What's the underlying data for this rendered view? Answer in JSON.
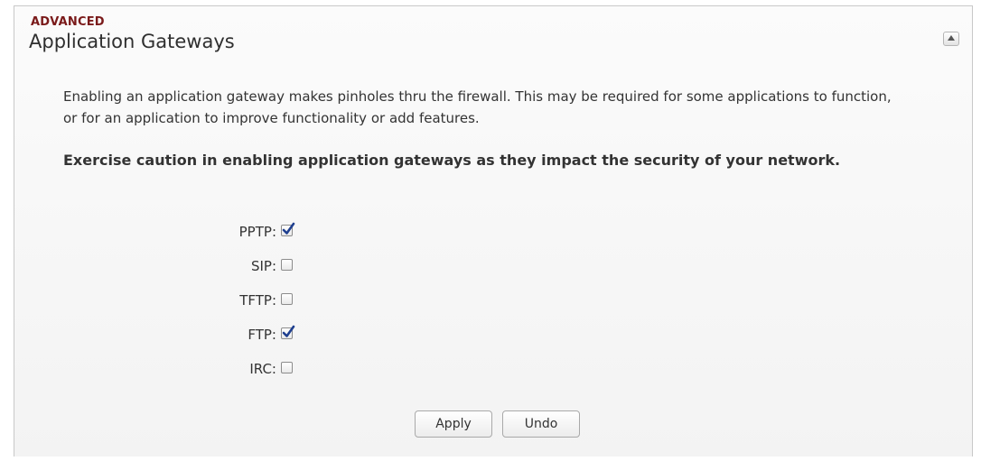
{
  "header": {
    "section": "ADVANCED",
    "title": "Application Gateways",
    "collapse_icon": "collapse-up-icon"
  },
  "description": "Enabling an application gateway makes pinholes thru the firewall. This may be required for some applications to function, or for an application to improve functionality or add features.",
  "warning": "Exercise caution in enabling application gateways as they impact the security of your network.",
  "gateways": [
    {
      "label": "PPTP:",
      "checked": true
    },
    {
      "label": "SIP:",
      "checked": false
    },
    {
      "label": "TFTP:",
      "checked": false
    },
    {
      "label": "FTP:",
      "checked": true
    },
    {
      "label": "IRC:",
      "checked": false
    }
  ],
  "buttons": {
    "apply": "Apply",
    "undo": "Undo"
  },
  "colors": {
    "section_label": "#7a1a1a",
    "checkmark": "#1f3f8f"
  }
}
